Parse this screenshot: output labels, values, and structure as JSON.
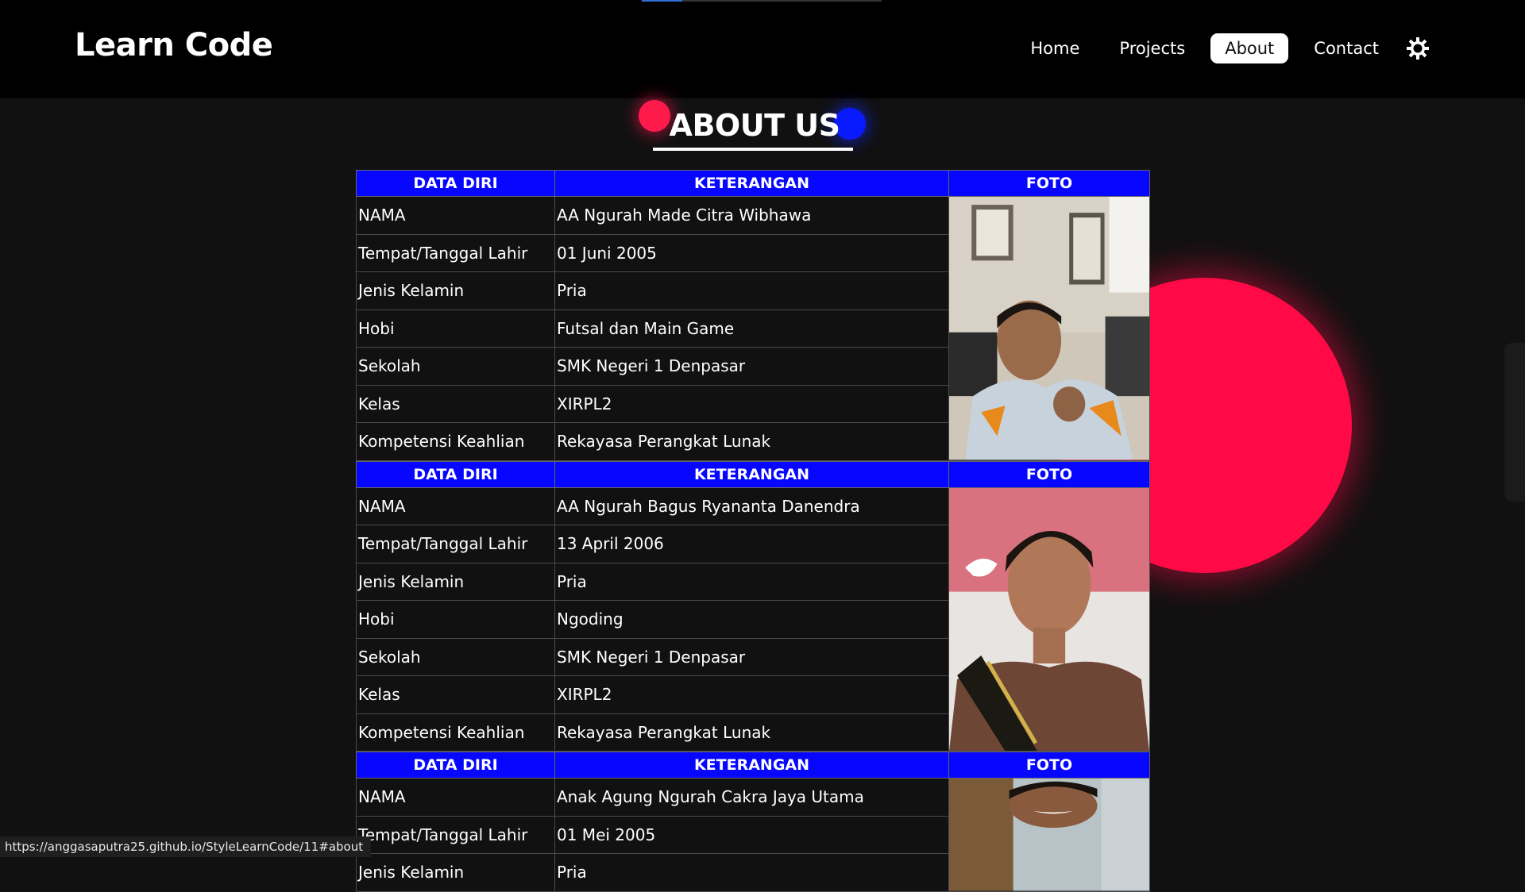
{
  "header": {
    "logo": "Learn Code",
    "nav": [
      "Home",
      "Projects",
      "About",
      "Contact"
    ],
    "active_nav": "About",
    "scroll_progress": 0.17
  },
  "colors": {
    "accent_red": "#ff0a46",
    "accent_blue": "#0707ff",
    "background": "#111111"
  },
  "heading": "ABOUT US",
  "table_headers": {
    "col1": "DATA DIRI",
    "col2": "KETERANGAN",
    "col3": "FOTO"
  },
  "people": [
    {
      "rows": [
        {
          "label": "NAMA",
          "value": "AA Ngurah Made Citra Wibhawa"
        },
        {
          "label": "Tempat/Tanggal Lahir",
          "value": "01 Juni 2005"
        },
        {
          "label": "Jenis Kelamin",
          "value": "Pria"
        },
        {
          "label": "Hobi",
          "value": "Futsal dan Main Game"
        },
        {
          "label": "Sekolah",
          "value": "SMK Negeri 1 Denpasar"
        },
        {
          "label": "Kelas",
          "value": "XIRPL2"
        },
        {
          "label": "Kompetensi Keahlian",
          "value": "Rekayasa Perangkat Lunak"
        }
      ]
    },
    {
      "rows": [
        {
          "label": "NAMA",
          "value": "AA Ngurah Bagus Ryananta Danendra"
        },
        {
          "label": "Tempat/Tanggal Lahir",
          "value": "13 April 2006"
        },
        {
          "label": "Jenis Kelamin",
          "value": "Pria"
        },
        {
          "label": "Hobi",
          "value": "Ngoding"
        },
        {
          "label": "Sekolah",
          "value": "SMK Negeri 1 Denpasar"
        },
        {
          "label": "Kelas",
          "value": "XIRPL2"
        },
        {
          "label": "Kompetensi Keahlian",
          "value": "Rekayasa Perangkat Lunak"
        }
      ]
    },
    {
      "rows": [
        {
          "label": "NAMA",
          "value": "Anak Agung Ngurah Cakra Jaya Utama"
        },
        {
          "label": "Tempat/Tanggal Lahir",
          "value": "01 Mei 2005"
        },
        {
          "label": "Jenis Kelamin",
          "value": "Pria"
        }
      ]
    }
  ],
  "status_url": "https://anggasaputra25.github.io/StyleLearnCode/11#about"
}
